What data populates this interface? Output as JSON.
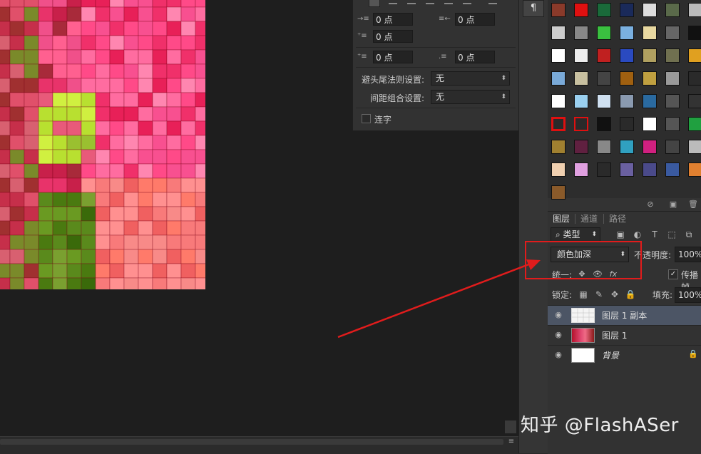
{
  "paragraph_panel": {
    "indent_left_value": "0 点",
    "indent_right_value": "0 点",
    "first_line_indent_value": "0 点",
    "space_before_value": "0 点",
    "space_after_value": "0 点",
    "kinsoku_label": "避头尾法则设置:",
    "kinsoku_value": "无",
    "mojikumi_label": "间距组合设置:",
    "mojikumi_value": "无",
    "hyphenate_label": "连字"
  },
  "strip": {
    "paragraph_button": "¶"
  },
  "layers_panel": {
    "tabs": [
      "图层",
      "通道",
      "路径"
    ],
    "filter_kind": "类型",
    "blend_mode": "颜色加深",
    "opacity_label": "不透明度:",
    "opacity_value": "100%",
    "unify_label": "统一:",
    "propagate_label": "传播帧",
    "lock_label": "锁定:",
    "fill_label": "填充:",
    "fill_value": "100%",
    "layers": [
      {
        "name": "图层 1 副本",
        "selected": true,
        "locked": false
      },
      {
        "name": "图层 1",
        "selected": false,
        "locked": false
      },
      {
        "name": "背景",
        "selected": false,
        "locked": true
      }
    ]
  },
  "watermark": "知乎 @FlashASer",
  "colors": {
    "annotation": "#e11c1c",
    "selected_layer": "#4c5565",
    "panel_bg": "#323232"
  }
}
